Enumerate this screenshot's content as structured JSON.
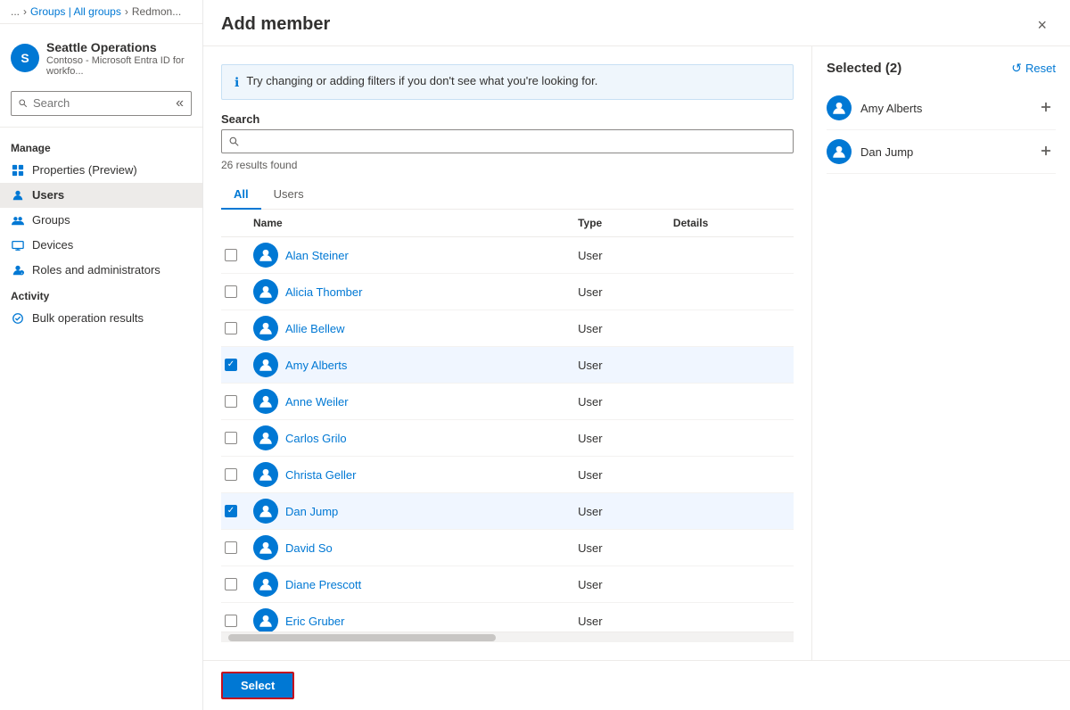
{
  "breadcrumb": {
    "items": [
      "...",
      "Groups | All groups",
      "Redmon..."
    ]
  },
  "sidebar": {
    "org_name": "Seattle Operations",
    "org_sub": "Contoso - Microsoft Entra ID for workfo...",
    "org_initial": "S",
    "search_placeholder": "Search",
    "collapse_label": "«",
    "manage_section": "Manage",
    "activity_section": "Activity",
    "nav_items": [
      {
        "id": "properties",
        "label": "Properties (Preview)",
        "icon": "properties-icon"
      },
      {
        "id": "users",
        "label": "Users",
        "icon": "users-icon",
        "active": true
      },
      {
        "id": "groups",
        "label": "Groups",
        "icon": "groups-icon"
      },
      {
        "id": "devices",
        "label": "Devices",
        "icon": "devices-icon"
      },
      {
        "id": "roles",
        "label": "Roles and administrators",
        "icon": "roles-icon"
      },
      {
        "id": "bulk",
        "label": "Bulk operation results",
        "icon": "bulk-icon"
      }
    ]
  },
  "modal": {
    "title": "Add member",
    "close_label": "×",
    "info_message": "Try changing or adding filters if you don't see what you're looking for.",
    "search_label": "Search",
    "search_placeholder": "",
    "results_count": "26 results found",
    "tabs": [
      {
        "id": "all",
        "label": "All",
        "active": true
      },
      {
        "id": "users",
        "label": "Users",
        "active": false
      }
    ],
    "table": {
      "headers": [
        "",
        "Name",
        "Type",
        "Details"
      ],
      "rows": [
        {
          "id": 1,
          "name": "Alan Steiner",
          "type": "User",
          "checked": false
        },
        {
          "id": 2,
          "name": "Alicia Thomber",
          "type": "User",
          "checked": false
        },
        {
          "id": 3,
          "name": "Allie Bellew",
          "type": "User",
          "checked": false
        },
        {
          "id": 4,
          "name": "Amy Alberts",
          "type": "User",
          "checked": true
        },
        {
          "id": 5,
          "name": "Anne Weiler",
          "type": "User",
          "checked": false
        },
        {
          "id": 6,
          "name": "Carlos Grilo",
          "type": "User",
          "checked": false
        },
        {
          "id": 7,
          "name": "Christa Geller",
          "type": "User",
          "checked": false
        },
        {
          "id": 8,
          "name": "Dan Jump",
          "type": "User",
          "checked": true
        },
        {
          "id": 9,
          "name": "David So",
          "type": "User",
          "checked": false
        },
        {
          "id": 10,
          "name": "Diane Prescott",
          "type": "User",
          "checked": false
        },
        {
          "id": 11,
          "name": "Eric Gruber",
          "type": "User",
          "checked": false
        }
      ]
    },
    "footer": {
      "select_label": "Select"
    }
  },
  "selected_panel": {
    "title": "Selected (2)",
    "reset_label": "Reset",
    "items": [
      {
        "id": 1,
        "name": "Amy Alberts"
      },
      {
        "id": 2,
        "name": "Dan Jump"
      }
    ]
  }
}
